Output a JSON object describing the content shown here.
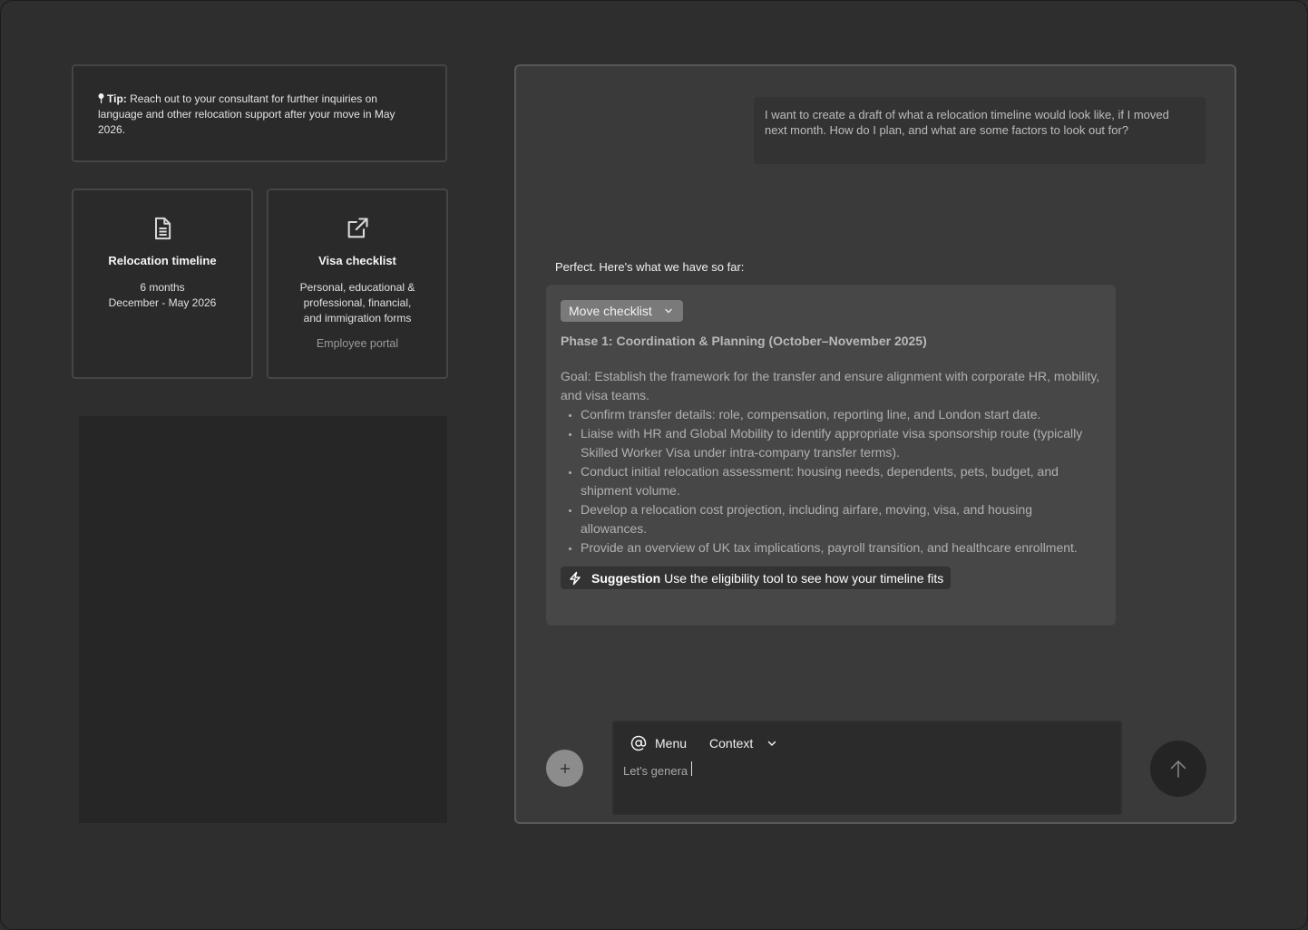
{
  "tip": {
    "label": "Tip:",
    "text": " Reach out to your consultant for further inquiries on language and other relocation support after your move in May 2026."
  },
  "cards": [
    {
      "icon": "document-icon",
      "title": "Relocation timeline",
      "lines": [
        "6 months",
        "December - May 2026"
      ]
    },
    {
      "icon": "external-link-icon",
      "title": "Visa checklist",
      "lines": [
        "Personal, educational &",
        "professional, financial,",
        "and immigration forms"
      ],
      "link": "Employee portal"
    }
  ],
  "chat": {
    "user_message": "I want to create a draft of what a relocation timeline would look like, if I moved next month. How do I plan, and what are some factors to look out for?",
    "assistant_intro": "Perfect. Here's what we have so far:",
    "response": {
      "dropdown_label": "Move checklist",
      "phase_title": "Phase 1: Coordination & Planning (October–November 2025)",
      "goal": "Goal: Establish the framework for the transfer and ensure alignment with corporate HR, mobility, and visa teams.",
      "items": [
        "Confirm transfer details: role, compensation, reporting line, and London start date.",
        "Liaise with HR and Global Mobility to identify appropriate visa sponsorship route (typically Skilled Worker Visa under intra-company transfer terms).",
        "Conduct initial relocation assessment: housing needs, dependents, pets, budget, and shipment volume.",
        "Develop a relocation cost projection, including airfare, moving, visa, and housing allowances.",
        "Provide an overview of UK tax implications, payroll transition, and healthcare enrollment."
      ],
      "suggestion_label": "Suggestion",
      "suggestion_text": " Use the eligibility tool to see how your timeline fits"
    }
  },
  "composer": {
    "menu_label": "Menu",
    "context_label": "Context",
    "input_value": "Let's genera"
  },
  "colors": {
    "background": "#2e2e2e",
    "chat_panel": "#3a3a3a",
    "response_card": "#474747"
  }
}
